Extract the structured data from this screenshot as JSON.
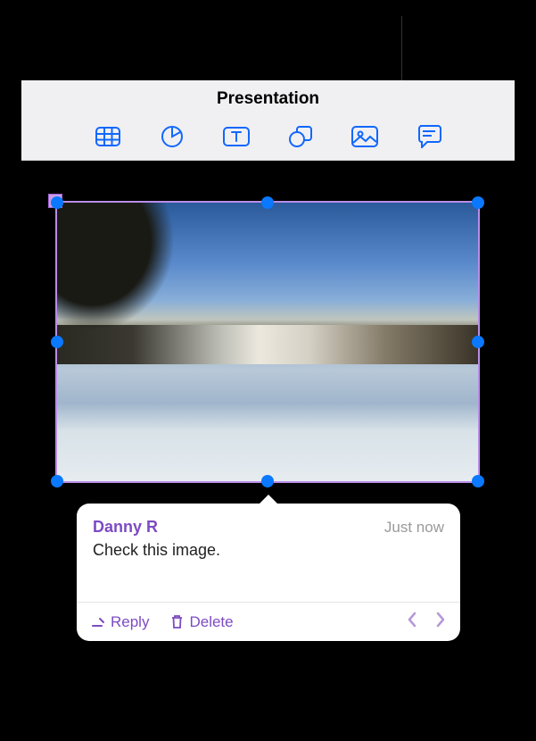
{
  "header": {
    "title": "Presentation"
  },
  "toolbar": {
    "items": [
      {
        "name": "table-icon"
      },
      {
        "name": "chart-icon"
      },
      {
        "name": "text-icon"
      },
      {
        "name": "shape-icon"
      },
      {
        "name": "image-icon"
      },
      {
        "name": "comment-icon"
      }
    ]
  },
  "colors": {
    "accent": "#1167ff",
    "selection": "#b88de8",
    "handle": "#0a78ff",
    "comment_accent": "#7d4bc2"
  },
  "comment": {
    "author": "Danny R",
    "timestamp": "Just now",
    "text": "Check this image.",
    "actions": {
      "reply": "Reply",
      "delete": "Delete"
    }
  }
}
